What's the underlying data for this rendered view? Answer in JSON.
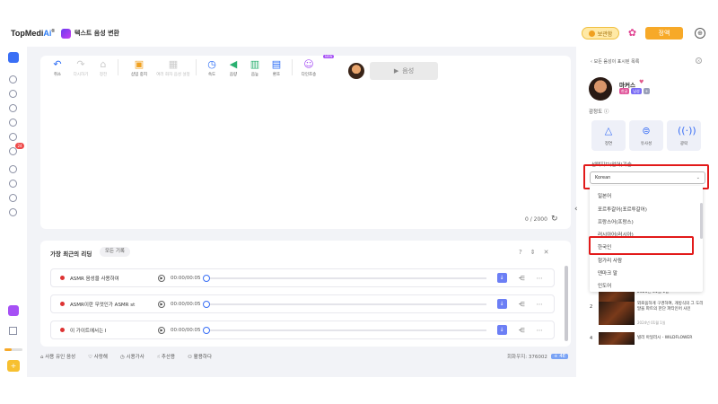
{
  "header": {
    "logo_main": "TopMedi",
    "logo_ai": "Ai",
    "logo_reg": "®",
    "app_title": "텍스트 음성 변환",
    "coin_label": "보관함",
    "upgrade_label": "정액"
  },
  "toolbar": {
    "items": [
      {
        "label": "취소",
        "icon": "undo-icon",
        "enabled": true
      },
      {
        "label": "다시하기",
        "icon": "redo-icon",
        "enabled": false
      },
      {
        "label": "정전",
        "icon": "clear-icon",
        "enabled": false
      },
      {
        "label": "삽입 중지",
        "icon": "pause-insert-icon",
        "enabled": true
      },
      {
        "label": "여러 화자 음성 설정",
        "icon": "multi-speaker-icon",
        "enabled": false
      },
      {
        "label": "속도",
        "icon": "speed-icon",
        "enabled": true
      },
      {
        "label": "음량",
        "icon": "volume-icon",
        "enabled": true
      },
      {
        "label": "음높",
        "icon": "pitch-icon",
        "enabled": true
      },
      {
        "label": "환호",
        "icon": "effect-icon",
        "enabled": true
      },
      {
        "label": "다인조송",
        "icon": "multi-voice-icon",
        "enabled": true
      }
    ],
    "new_badge": "NEW",
    "play_label": "음성"
  },
  "editor": {
    "counter": "0 / 2000"
  },
  "history": {
    "title": "가장 최근의 리딩",
    "all_records": "모든 기록",
    "rows": [
      {
        "name": "ASMR 음성을 사용하여",
        "time": "00:00/00:05"
      },
      {
        "name": "ASMR이란 무엇인가 ASMR st",
        "time": "00:00/00:05"
      },
      {
        "name": "이 가이트에서는 I",
        "time": "00:00/00:05"
      }
    ]
  },
  "footer": {
    "links": [
      "사용 유인 음성",
      "사랑해",
      "시용가사",
      "추산용",
      "활용하다"
    ],
    "remaining_label": "회화우지: 376002",
    "remaining_tag": "+ 4E"
  },
  "right_panel": {
    "back_label": "모든 음성이 표시된 목록",
    "voice_name": "마커스",
    "voice_tags": [
      {
        "text": "한글",
        "color": "#e0559a"
      },
      {
        "text": "남성",
        "color": "#7a6cf5"
      },
      {
        "text": "+",
        "color": "#9aa0b8"
      }
    ],
    "emotion_label": "감정도",
    "emotion_cards": [
      {
        "label": "정연",
        "icon": "triangle-icon"
      },
      {
        "label": "유사성",
        "icon": "similarity-icon"
      },
      {
        "label": "광락",
        "icon": "broadcast-icon"
      }
    ],
    "language_label": "선택지보(언어)기술",
    "language_selected": "Korean",
    "language_options": [
      "일본어",
      "포르투갈어(포르투갈어)",
      "프랑스어(프랑스)",
      "러시아어(러시아)",
      "한국인",
      "헝가리 사람",
      "덴마크 말",
      "인도어"
    ],
    "highlighted_option": "한국인",
    "videos": [
      {
        "rank": "",
        "title": "2023년 01월 1일",
        "sub": ""
      },
      {
        "rank": "2",
        "title": "외로움하게 구경하여, 개방식의 그 도리 말을 파트의 한단 파티인어 사인",
        "sub": "2024년 01월 1일"
      },
      {
        "rank": "4",
        "title": "빌리 아일리시 - WILDFLOWER",
        "sub": ""
      }
    ]
  }
}
